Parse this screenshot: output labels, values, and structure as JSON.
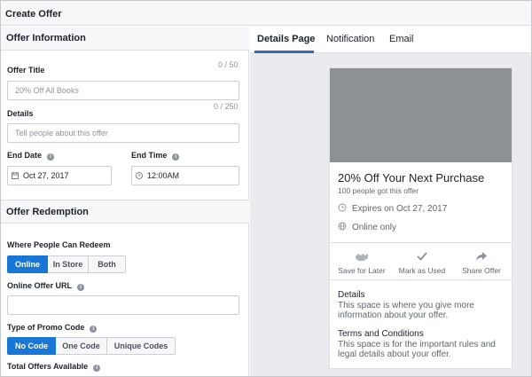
{
  "window": {
    "title": "Create Offer"
  },
  "offer_information": {
    "heading": "Offer Information",
    "offer_title": {
      "label": "Offer Title",
      "counter": "0 / 50",
      "placeholder": "20% Off All Books"
    },
    "details": {
      "label": "Details",
      "counter": "0 / 250",
      "placeholder": "Tell people about this offer"
    },
    "end_date": {
      "label": "End Date",
      "value": "Oct 27, 2017"
    },
    "end_time": {
      "label": "End Time",
      "value": "12:00AM"
    }
  },
  "offer_redemption": {
    "heading": "Offer Redemption",
    "where_redeem": {
      "label": "Where People Can Redeem",
      "options": [
        "Online",
        "In Store",
        "Both"
      ],
      "selected": "Online"
    },
    "online_url": {
      "label": "Online Offer URL",
      "value": ""
    },
    "promo_code": {
      "label": "Type of Promo Code",
      "options": [
        "No Code",
        "One Code",
        "Unique Codes"
      ],
      "selected": "No Code"
    },
    "total_offers": {
      "label": "Total Offers Available"
    }
  },
  "preview": {
    "tabs": [
      "Details Page",
      "Notification",
      "Email"
    ],
    "active_tab": "Details Page",
    "card": {
      "title": "20% Off Your Next Purchase",
      "subtitle": "100 people got this offer",
      "expires": "Expires on Oct 27, 2017",
      "location": "Online only",
      "actions": [
        "Save for Later",
        "Mark as Used",
        "Share Offer"
      ],
      "details_heading": "Details",
      "details_text": "This space is where you give more information about your offer.",
      "terms_heading": "Terms and Conditions",
      "terms_text": "This space is for the important rules and legal details about your offer."
    }
  },
  "colors": {
    "accent": "#1877d6",
    "tab_underline": "#4267b2",
    "image_placeholder": "#8d9094"
  }
}
